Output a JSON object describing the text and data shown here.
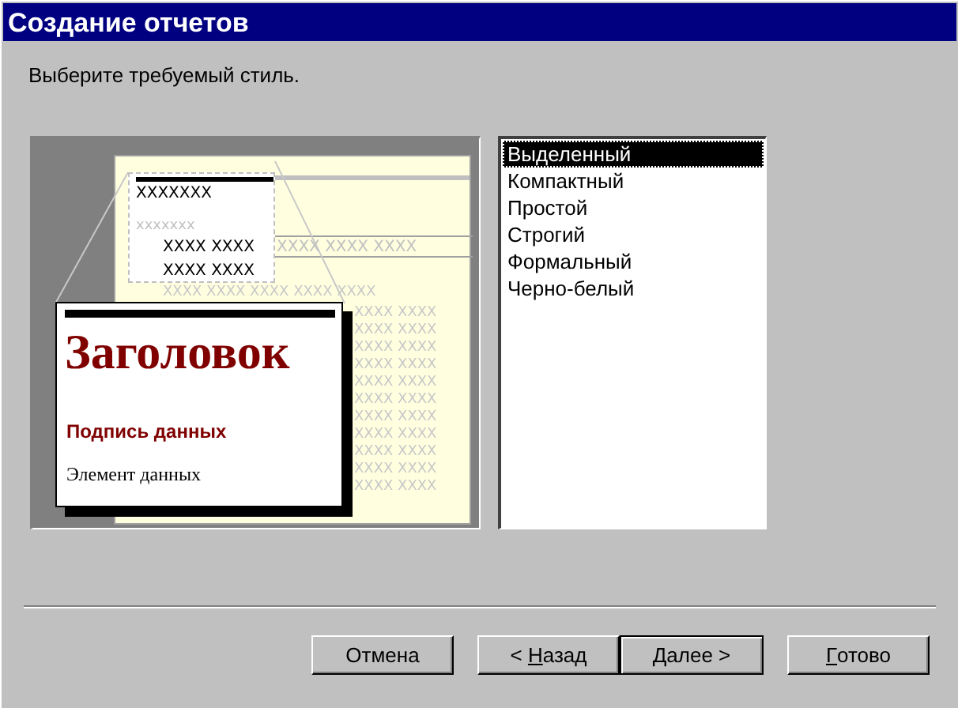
{
  "window": {
    "title": "Создание отчетов"
  },
  "instruction": "Выберите требуемый стиль.",
  "preview": {
    "header_text": "XXXXXXX",
    "group_text": "xxxxxxx",
    "detail_rows": [
      "XXXX XXXX",
      "XXXX XXXX"
    ],
    "column_filler": "XXXX XXXX XXXX",
    "first_filler_row": "XXXX XXXX XXXX XXXX XXXX",
    "filler_rows": [
      "XXXX XXXX",
      "XXXX XXXX",
      "XXXX XXXX",
      "XXXX XXXX",
      "XXXX XXXX",
      "XXXX XXXX",
      "XXXX XXXX",
      "XXXX XXXX",
      "XXXX XXXX",
      "XXXX XXXX",
      "XXXX XXXX"
    ],
    "callout": {
      "heading": "Заголовок",
      "label": "Подпись данных",
      "field": "Элемент данных"
    }
  },
  "styles": [
    {
      "label": "Выделенный",
      "selected": true
    },
    {
      "label": "Компактный",
      "selected": false
    },
    {
      "label": "Простой",
      "selected": false
    },
    {
      "label": "Строгий",
      "selected": false
    },
    {
      "label": "Формальный",
      "selected": false
    },
    {
      "label": "Черно-белый",
      "selected": false
    }
  ],
  "buttons": [
    {
      "after": "Отмена",
      "default": false
    },
    {
      "before": "< ",
      "accelerator": "Н",
      "after": "азад",
      "default": false
    },
    {
      "accelerator": "Д",
      "after": "алее >",
      "default": true
    },
    {
      "accelerator": "Г",
      "after": "отово",
      "default": false
    }
  ]
}
